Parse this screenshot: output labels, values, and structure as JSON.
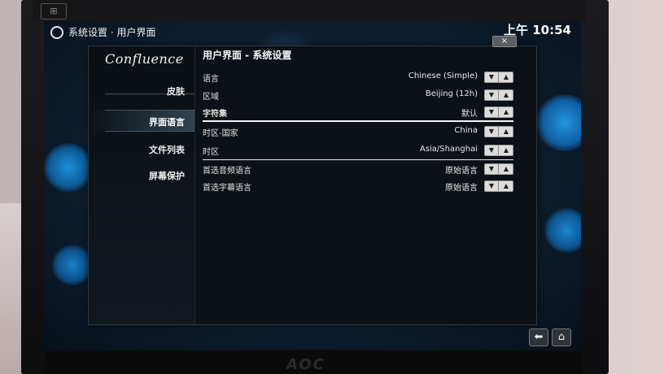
{
  "topbar": {
    "title": "系统设置 · 用户界面",
    "clock": "上午 10:54"
  },
  "dialog": {
    "title": "用户界面 - 系统设置",
    "close": "×"
  },
  "brand": "Confluence",
  "monitor_brand": "AOC",
  "sidebar": {
    "items": [
      {
        "label": "皮肤"
      },
      {
        "label": "界面语言"
      },
      {
        "label": "文件列表"
      },
      {
        "label": "屏幕保护"
      }
    ],
    "selected_index": 1
  },
  "settings": [
    {
      "label": "语言",
      "value": "Chinese (Simple)"
    },
    {
      "label": "区域",
      "value": "Beijing (12h)"
    },
    {
      "label": "字符集",
      "value": "默认"
    },
    {
      "label": "时区-国家",
      "value": "China"
    },
    {
      "label": "时区",
      "value": "Asia/Shanghai"
    },
    {
      "label": "首选音频语言",
      "value": "原始语言"
    },
    {
      "label": "首选字幕语言",
      "value": "原始语言"
    }
  ],
  "icons": {
    "spinner_down": "▼",
    "spinner_up": "▲",
    "back": "⬅",
    "home": "⌂",
    "settings": "settings-icon"
  }
}
